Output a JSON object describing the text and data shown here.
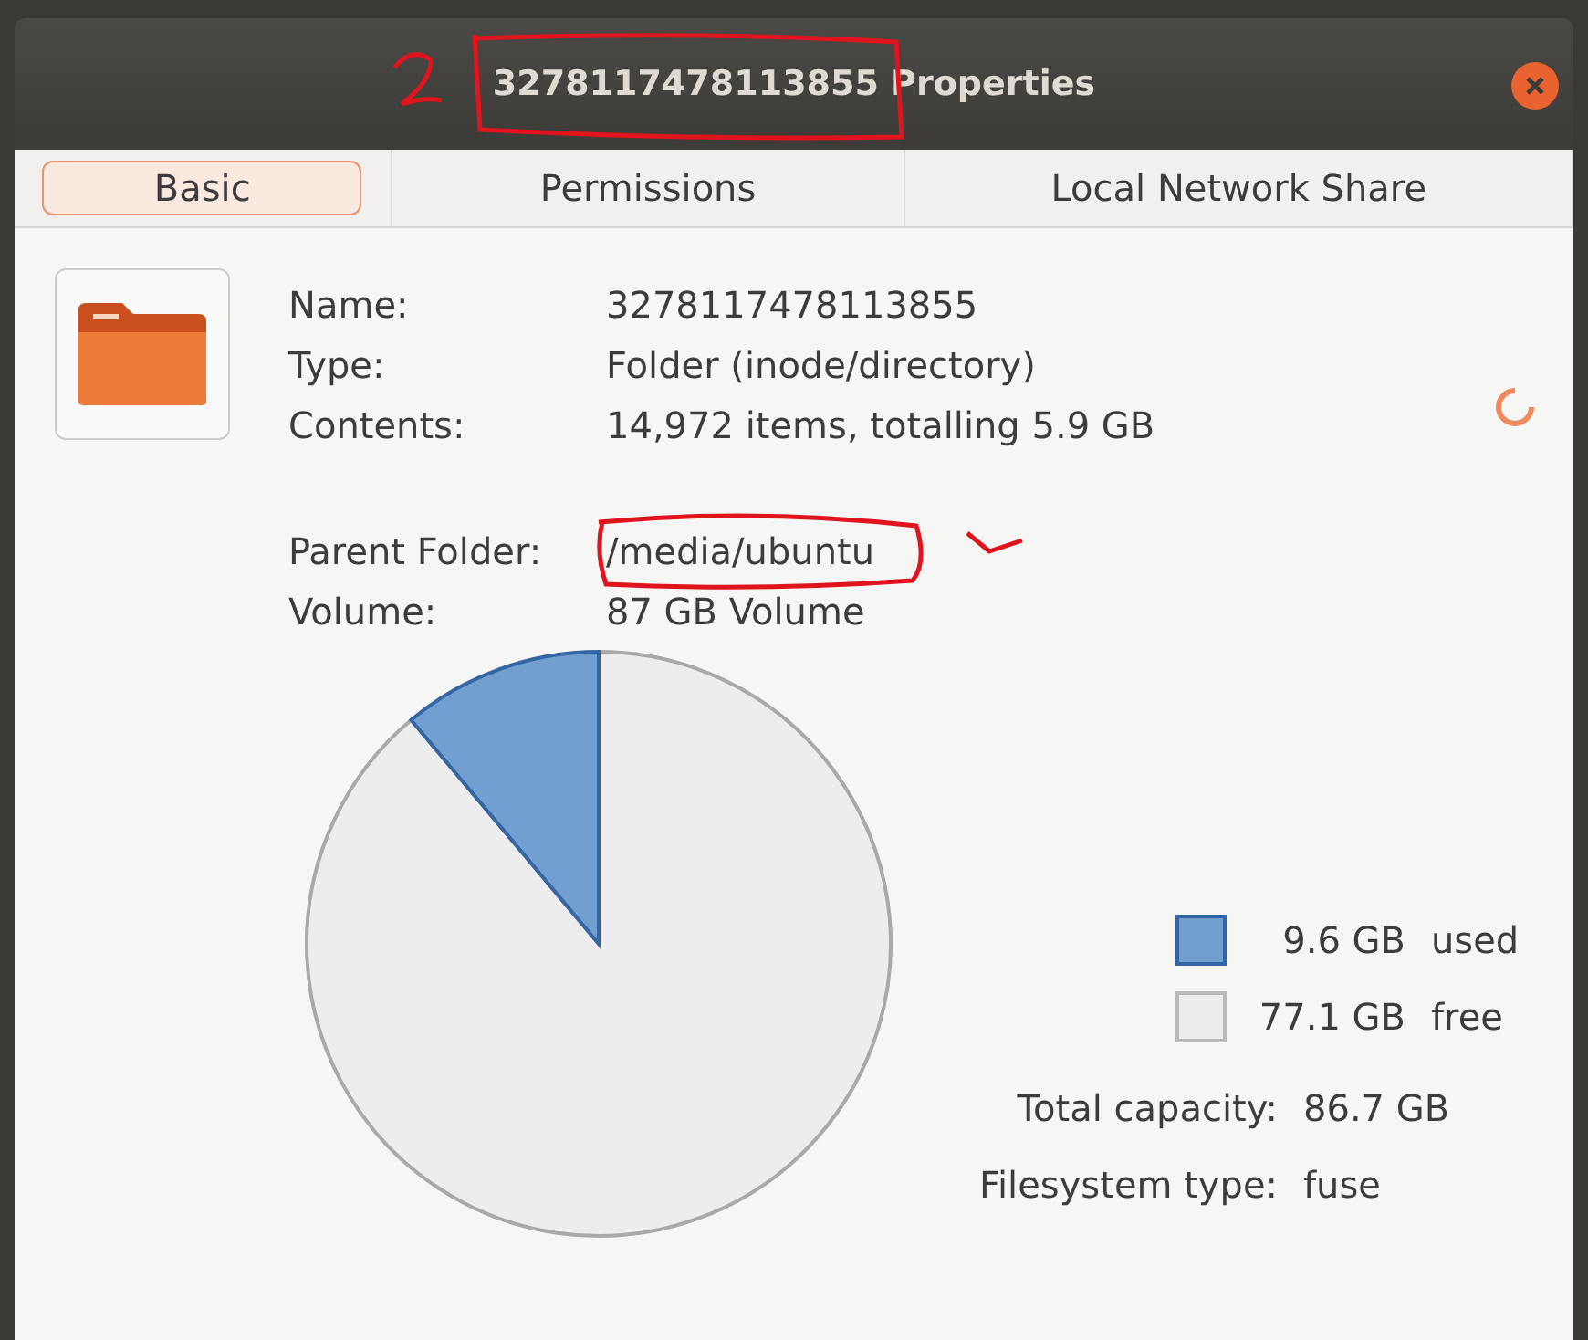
{
  "window": {
    "title": "3278117478113855 Properties"
  },
  "tabs": [
    {
      "label": "Basic",
      "selected": true
    },
    {
      "label": "Permissions",
      "selected": false
    },
    {
      "label": "Local Network Share",
      "selected": false
    }
  ],
  "info": [
    {
      "label": "Name:",
      "value": "3278117478113855",
      "annotated": false
    },
    {
      "label": "Type:",
      "value": "Folder (inode/directory)",
      "annotated": false
    },
    {
      "label": "Contents:",
      "value": "14,972 items, totalling 5.9 GB",
      "annotated": false
    },
    {
      "label": "Parent Folder:",
      "value": "/media/ubuntu",
      "annotated": true
    },
    {
      "label": "Volume:",
      "value": "87 GB Volume",
      "annotated": false
    }
  ],
  "usage": {
    "chart_data": {
      "type": "pie",
      "categories": [
        "used",
        "free"
      ],
      "values": [
        11.1,
        88.9
      ]
    },
    "legend": [
      {
        "value": "9.6 GB",
        "color": "#729fcf"
      },
      {
        "value": "77.1 GB",
        "color": "#ededed"
      }
    ],
    "details": [
      {
        "label": "Total capacity:",
        "value": "86.7 GB"
      },
      {
        "label": "Filesystem type:",
        "value": "fuse"
      }
    ]
  }
}
